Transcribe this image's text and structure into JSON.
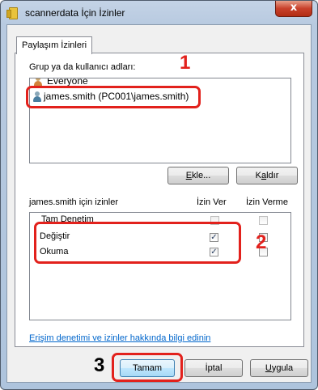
{
  "window": {
    "title": "scannerdata İçin İzinler",
    "close_glyph": "x"
  },
  "tab": {
    "label": "Paylaşım İzinleri"
  },
  "group_section": {
    "label": "Grup ya da kullanıcı adları:",
    "items": [
      {
        "name": "Everyone",
        "icon": "group-icon"
      },
      {
        "name": "james.smith (PC001\\james.smith)",
        "icon": "user-icon",
        "selected": true
      }
    ]
  },
  "buttons": {
    "add": {
      "label": "Ekle...",
      "underline": "E",
      "rest": "kle..."
    },
    "remove": {
      "label": "Kaldır",
      "underline": "a",
      "pre": "K",
      "rest": "ldır"
    },
    "ok": {
      "label": "Tamam"
    },
    "cancel": {
      "label": "İptal"
    },
    "apply": {
      "label": "Uygula",
      "underline": "U",
      "rest": "ygula"
    }
  },
  "permissions": {
    "heading": "james.smith için izinler",
    "col_allow": "İzin Ver",
    "col_deny": "İzin Verme",
    "rows": [
      {
        "name": "Tam Denetim",
        "allow": false,
        "deny": false
      },
      {
        "name": "Değiştir",
        "allow": true,
        "deny": false
      },
      {
        "name": "Okuma",
        "allow": true,
        "deny": false
      }
    ]
  },
  "help_link": "Erişim denetimi ve izinler hakkında bilgi edinin",
  "callouts": {
    "step1": "1",
    "step2": "2",
    "step3": "3"
  },
  "colors": {
    "callout": "#e2211c",
    "link": "#0066cc"
  }
}
